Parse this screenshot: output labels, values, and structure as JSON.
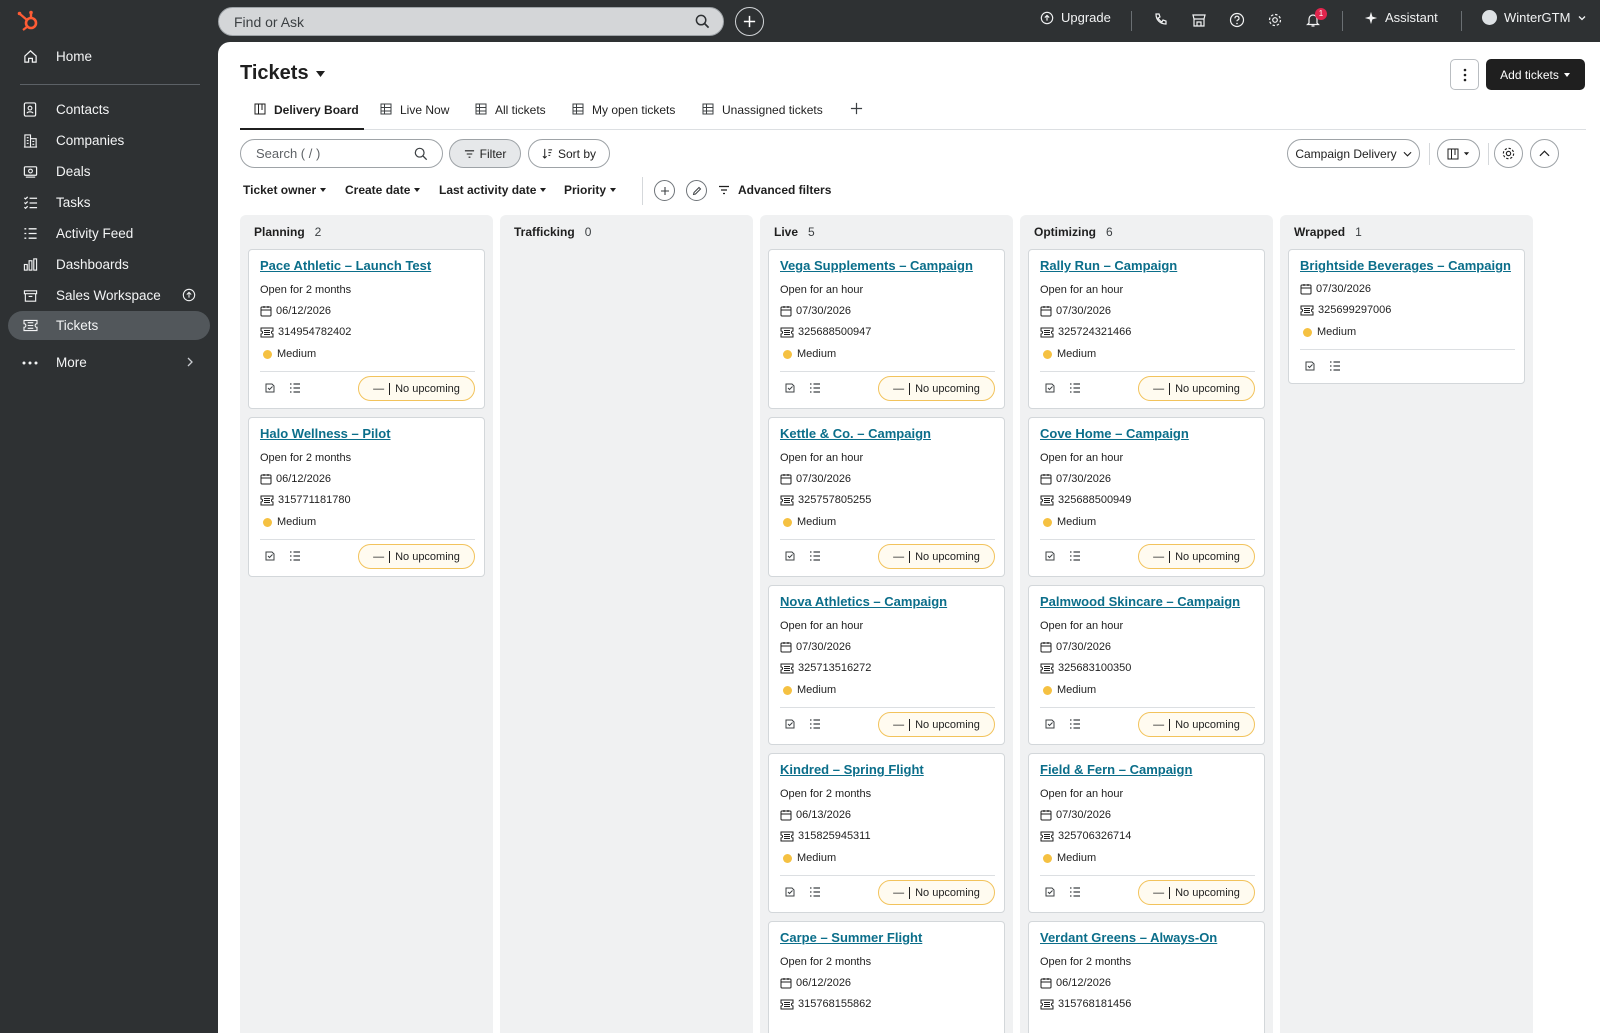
{
  "topbar": {
    "search_placeholder": "Find or Ask",
    "upgrade_label": "Upgrade",
    "notification_count": "1",
    "assistant_label": "Assistant",
    "account_label": "WinterGTM"
  },
  "sidebar": {
    "home": "Home",
    "items": [
      "Contacts",
      "Companies",
      "Deals",
      "Tasks",
      "Activity Feed",
      "Dashboards",
      "Sales Workspace",
      "Tickets"
    ],
    "more": "More"
  },
  "page": {
    "title": "Tickets",
    "add_button": "Add tickets",
    "tabs": [
      "Delivery Board",
      "Live Now",
      "All tickets",
      "My open tickets",
      "Unassigned tickets"
    ]
  },
  "toolbar": {
    "search_placeholder": "Search ( / )",
    "filter": "Filter",
    "sort": "Sort by",
    "pipeline": "Campaign Delivery",
    "filters": [
      "Ticket owner",
      "Create date",
      "Last activity date",
      "Priority"
    ],
    "advanced_filters": "Advanced filters"
  },
  "board": {
    "no_upcoming": "No upcoming",
    "columns": [
      {
        "name": "Planning",
        "count": "2",
        "cards": [
          {
            "title": "Pace Athletic – Launch Test",
            "open": "Open for 2 months",
            "date": "06/12/2026",
            "id": "314954782402",
            "priority": "Medium"
          },
          {
            "title": "Halo Wellness – Pilot",
            "open": "Open for 2 months",
            "date": "06/12/2026",
            "id": "315771181780",
            "priority": "Medium"
          }
        ]
      },
      {
        "name": "Trafficking",
        "count": "0",
        "cards": []
      },
      {
        "name": "Live",
        "count": "5",
        "cards": [
          {
            "title": "Vega Supplements – Campaign",
            "open": "Open for an hour",
            "date": "07/30/2026",
            "id": "325688500947",
            "priority": "Medium"
          },
          {
            "title": "Kettle & Co. – Campaign",
            "open": "Open for an hour",
            "date": "07/30/2026",
            "id": "325757805255",
            "priority": "Medium"
          },
          {
            "title": "Nova Athletics – Campaign",
            "open": "Open for an hour",
            "date": "07/30/2026",
            "id": "325713516272",
            "priority": "Medium"
          },
          {
            "title": "Kindred – Spring Flight",
            "open": "Open for 2 months",
            "date": "06/13/2026",
            "id": "315825945311",
            "priority": "Medium"
          },
          {
            "title": "Carpe – Summer Flight",
            "open": "Open for 2 months",
            "date": "06/12/2026",
            "id": "315768155862",
            "priority": ""
          }
        ]
      },
      {
        "name": "Optimizing",
        "count": "6",
        "cards": [
          {
            "title": "Rally Run – Campaign",
            "open": "Open for an hour",
            "date": "07/30/2026",
            "id": "325724321466",
            "priority": "Medium"
          },
          {
            "title": "Cove Home – Campaign",
            "open": "Open for an hour",
            "date": "07/30/2026",
            "id": "325688500949",
            "priority": "Medium"
          },
          {
            "title": "Palmwood Skincare – Campaign",
            "open": "Open for an hour",
            "date": "07/30/2026",
            "id": "325683100350",
            "priority": "Medium"
          },
          {
            "title": "Field & Fern – Campaign",
            "open": "Open for an hour",
            "date": "07/30/2026",
            "id": "325706326714",
            "priority": "Medium"
          },
          {
            "title": "Verdant Greens – Always-On",
            "open": "Open for 2 months",
            "date": "06/12/2026",
            "id": "315768181456",
            "priority": ""
          }
        ]
      },
      {
        "name": "Wrapped",
        "count": "1",
        "cards": [
          {
            "title": "Brightside Beverages – Campaign",
            "open": "",
            "date": "07/30/2026",
            "id": "325699297006",
            "priority": "Medium"
          }
        ]
      }
    ]
  }
}
